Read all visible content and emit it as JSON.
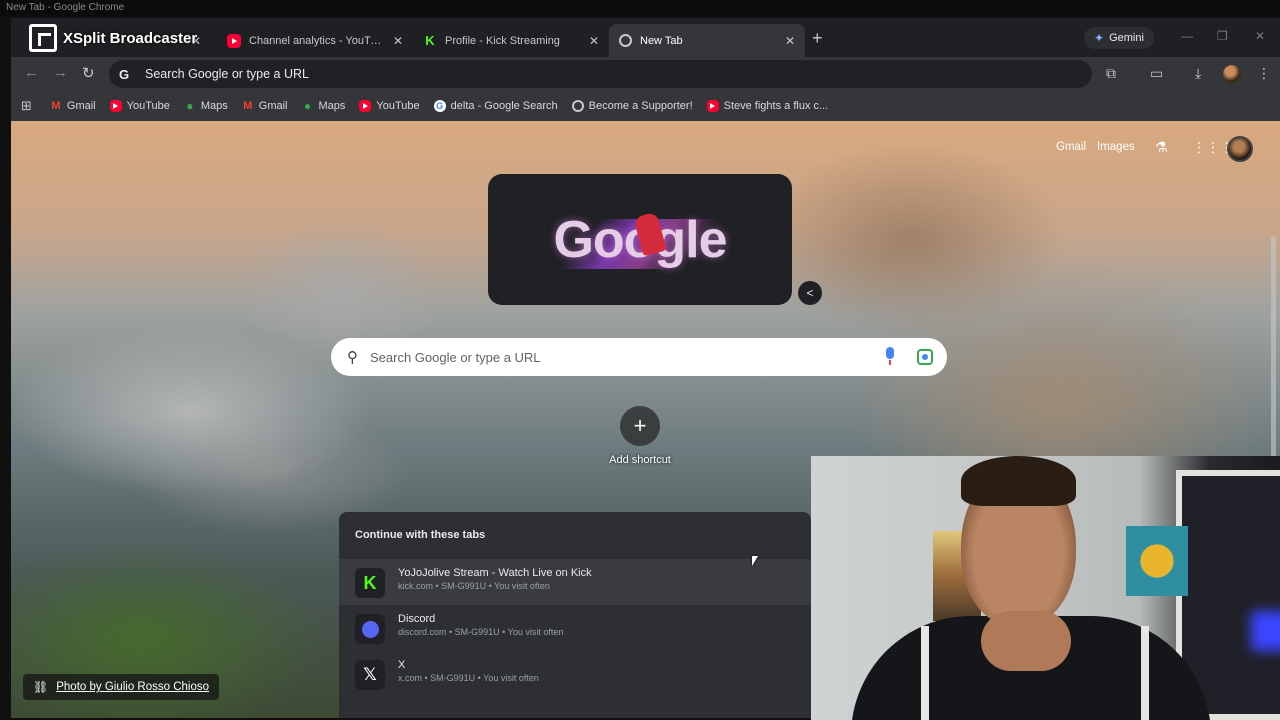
{
  "os": {
    "window_title": "New Tab - Google Chrome"
  },
  "overlay": {
    "app_name": "XSplit Broadcaster"
  },
  "tabs": [
    {
      "title": "",
      "icon": "xsplit-icon"
    },
    {
      "title": "Channel analytics - YouTube Studio",
      "icon": "youtube-icon"
    },
    {
      "title": "Profile - Kick Streaming",
      "icon": "kick-icon"
    },
    {
      "title": "New Tab",
      "icon": "chrome-icon",
      "active": true
    }
  ],
  "tab_controls": {
    "new_tab": "+",
    "close": "✕"
  },
  "gemini": {
    "label": "Gemini"
  },
  "window_controls": {
    "minimize": "—",
    "maximize": "❐",
    "close": "✕"
  },
  "toolbar": {
    "back": "←",
    "forward": "→",
    "reload": "↻",
    "omnibox_placeholder": "Search Google or type a URL"
  },
  "bookmarks": [
    {
      "label": "Gmail",
      "icon": "gmail-icon"
    },
    {
      "label": "YouTube",
      "icon": "youtube-icon"
    },
    {
      "label": "Maps",
      "icon": "maps-icon"
    },
    {
      "label": "Gmail",
      "icon": "gmail-icon"
    },
    {
      "label": "Maps",
      "icon": "maps-icon"
    },
    {
      "label": "YouTube",
      "icon": "youtube-icon"
    },
    {
      "label": "delta - Google Search",
      "icon": "google-icon"
    },
    {
      "label": "Become a Supporter!",
      "icon": "globe-icon"
    },
    {
      "label": "Steve fights a flux c...",
      "icon": "youtube-icon"
    }
  ],
  "ntp": {
    "gmail_link": "Gmail",
    "images_link": "Images",
    "doodle_text": "Google",
    "search_placeholder": "Search Google or type a URL",
    "add_shortcut": "Add shortcut",
    "add_symbol": "+",
    "photo_credit": "Photo by Giulio Rosso Chioso"
  },
  "continue_tabs": {
    "heading": "Continue with these tabs",
    "items": [
      {
        "title": "YoJoJolive Stream - Watch Live on Kick",
        "subtitle": "kick.com • SM-G991U • You visit often",
        "icon": "kick-icon",
        "glyph": "K"
      },
      {
        "title": "Discord",
        "subtitle": "discord.com • SM-G991U • You visit often",
        "icon": "discord-icon",
        "glyph": ""
      },
      {
        "title": "X",
        "subtitle": "x.com • SM-G991U • You visit often",
        "icon": "x-icon",
        "glyph": "𝕏"
      }
    ]
  },
  "colors": {
    "accent": "#8ab4f8",
    "kick_green": "#53fc18",
    "youtube_red": "#ff0033",
    "discord": "#5865f2"
  }
}
